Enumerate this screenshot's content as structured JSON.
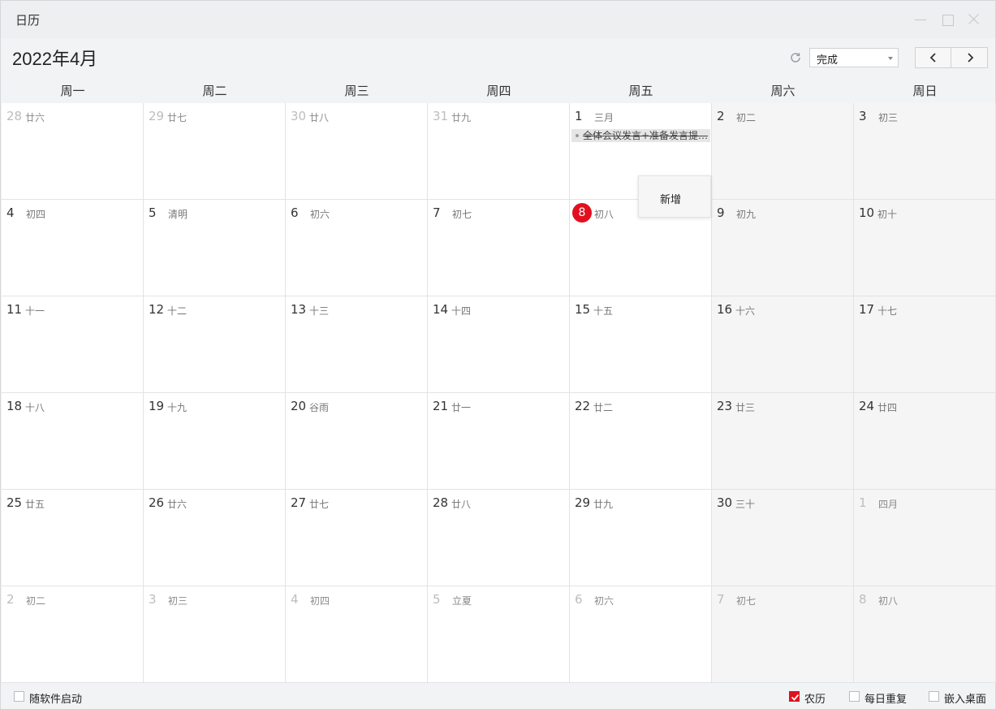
{
  "window": {
    "title": "日历"
  },
  "header": {
    "month_title": "2022年4月",
    "status_value": "完成"
  },
  "weekdays": [
    "周一",
    "周二",
    "周三",
    "周四",
    "周五",
    "周六",
    "周日"
  ],
  "weeks": [
    [
      {
        "day": "28",
        "lunar": "廿六",
        "other": true
      },
      {
        "day": "29",
        "lunar": "廿七",
        "other": true
      },
      {
        "day": "30",
        "lunar": "廿八",
        "other": true
      },
      {
        "day": "31",
        "lunar": "廿九",
        "other": true
      },
      {
        "day": "1",
        "lunar": "三月",
        "other": false
      },
      {
        "day": "2",
        "lunar": "初二",
        "other": false
      },
      {
        "day": "3",
        "lunar": "初三",
        "other": false
      }
    ],
    [
      {
        "day": "4",
        "lunar": "初四",
        "other": false
      },
      {
        "day": "5",
        "lunar": "清明",
        "other": false
      },
      {
        "day": "6",
        "lunar": "初六",
        "other": false
      },
      {
        "day": "7",
        "lunar": "初七",
        "other": false
      },
      {
        "day": "8",
        "lunar": "初八",
        "other": false,
        "today": true
      },
      {
        "day": "9",
        "lunar": "初九",
        "other": false
      },
      {
        "day": "10",
        "lunar": "初十",
        "other": false
      }
    ],
    [
      {
        "day": "11",
        "lunar": "十一",
        "other": false
      },
      {
        "day": "12",
        "lunar": "十二",
        "other": false
      },
      {
        "day": "13",
        "lunar": "十三",
        "other": false
      },
      {
        "day": "14",
        "lunar": "十四",
        "other": false
      },
      {
        "day": "15",
        "lunar": "十五",
        "other": false
      },
      {
        "day": "16",
        "lunar": "十六",
        "other": false
      },
      {
        "day": "17",
        "lunar": "十七",
        "other": false
      }
    ],
    [
      {
        "day": "18",
        "lunar": "十八",
        "other": false
      },
      {
        "day": "19",
        "lunar": "十九",
        "other": false
      },
      {
        "day": "20",
        "lunar": "谷雨",
        "other": false
      },
      {
        "day": "21",
        "lunar": "廿一",
        "other": false
      },
      {
        "day": "22",
        "lunar": "廿二",
        "other": false
      },
      {
        "day": "23",
        "lunar": "廿三",
        "other": false
      },
      {
        "day": "24",
        "lunar": "廿四",
        "other": false
      }
    ],
    [
      {
        "day": "25",
        "lunar": "廿五",
        "other": false
      },
      {
        "day": "26",
        "lunar": "廿六",
        "other": false
      },
      {
        "day": "27",
        "lunar": "廿七",
        "other": false
      },
      {
        "day": "28",
        "lunar": "廿八",
        "other": false
      },
      {
        "day": "29",
        "lunar": "廿九",
        "other": false
      },
      {
        "day": "30",
        "lunar": "三十",
        "other": false
      },
      {
        "day": "1",
        "lunar": "四月",
        "other": true
      }
    ],
    [
      {
        "day": "2",
        "lunar": "初二",
        "other": true
      },
      {
        "day": "3",
        "lunar": "初三",
        "other": true
      },
      {
        "day": "4",
        "lunar": "初四",
        "other": true
      },
      {
        "day": "5",
        "lunar": "立夏",
        "other": true
      },
      {
        "day": "6",
        "lunar": "初六",
        "other": true
      },
      {
        "day": "7",
        "lunar": "初七",
        "other": true
      },
      {
        "day": "8",
        "lunar": "初八",
        "other": true
      }
    ]
  ],
  "event": {
    "text": "全体会议发言+准备发言提…",
    "completed": true
  },
  "context_menu": {
    "add_label": "新增"
  },
  "footer": {
    "autostart_label": "随软件启动",
    "autostart_checked": false,
    "lunar_label": "农历",
    "lunar_checked": true,
    "repeat_label": "每日重复",
    "repeat_checked": false,
    "embed_label": "嵌入桌面",
    "embed_checked": false
  },
  "colors": {
    "accent": "#e2101e",
    "weekend_bg": "#f5f5f6",
    "event_bg": "#e6e6e6"
  },
  "icons": {
    "refresh": "refresh-icon",
    "prev": "chevron-left-icon",
    "next": "chevron-right-icon"
  }
}
